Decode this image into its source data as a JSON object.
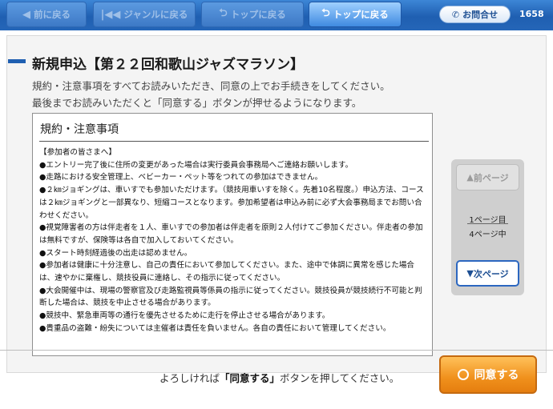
{
  "nav": {
    "back_label": "前に戻る",
    "genre_label": "ジャンルに戻る",
    "top_disabled_label": "トップに戻る",
    "top_active_label": "トップに戻る",
    "contact_label": "お問合せ",
    "counter": "1658"
  },
  "page": {
    "title": "新規申込【第２２回和歌山ジャズマラソン】",
    "intro_line1": "規約・注意事項をすべてお読みいただき、同意の上でお手続きをしてください。",
    "intro_line2": "最後までお読みいただくと「同意する」ボタンが押せるようになります。"
  },
  "terms": {
    "heading": "規約・注意事項",
    "lines": [
      "【参加者の皆さまへ】",
      "●エントリー完了後に住所の変更があった場合は実行委員会事務局へご連絡お願いします。",
      "●走路における安全管理上、ベビーカー・ペット等をつれての参加はできません。",
      "●２㎞ジョギングは、車いすでも参加いただけます。（競技用車いすを除く。先着10名程度。）申込方法、コースは２㎞ジョギングと一部異なり、短縮コースとなります。参加希望者は申込み前に必ず大会事務局までお問い合わせください。",
      "●視覚障害者の方は伴走者を１人、車いすでの参加者は伴走者を原則２人付けてご参加ください。伴走者の参加は無料ですが、保険等は各自で加入しておいてください。",
      "●スタート時刻経過後の出走は認めません。",
      "●参加者は健康に十分注意し、自己の責任において参加してください。また、途中で体調に異常を感じた場合は、速やかに棄権し、競技役員に連絡し、その指示に従ってください。",
      "●大会開催中は、現場の警察官及び走路監視員等係員の指示に従ってください。競技役員が競技続行不可能と判断した場合は、競技を中止させる場合があります。",
      "●競技中、緊急車両等の通行を優先させるために走行を停止させる場合があります。",
      "●貴重品の盗難・紛失については主催者は責任を負いません。各自の責任において管理してください。"
    ]
  },
  "pager": {
    "prev_label": "前ページ",
    "current_page": "1ページ目",
    "total_pages": "4ページ中",
    "next_label": "次ページ"
  },
  "footer": {
    "instruction_pre": "よろしければ",
    "instruction_strong": "「同意する」",
    "instruction_post": "ボタンを押してください。",
    "agree_label": "同意する"
  }
}
